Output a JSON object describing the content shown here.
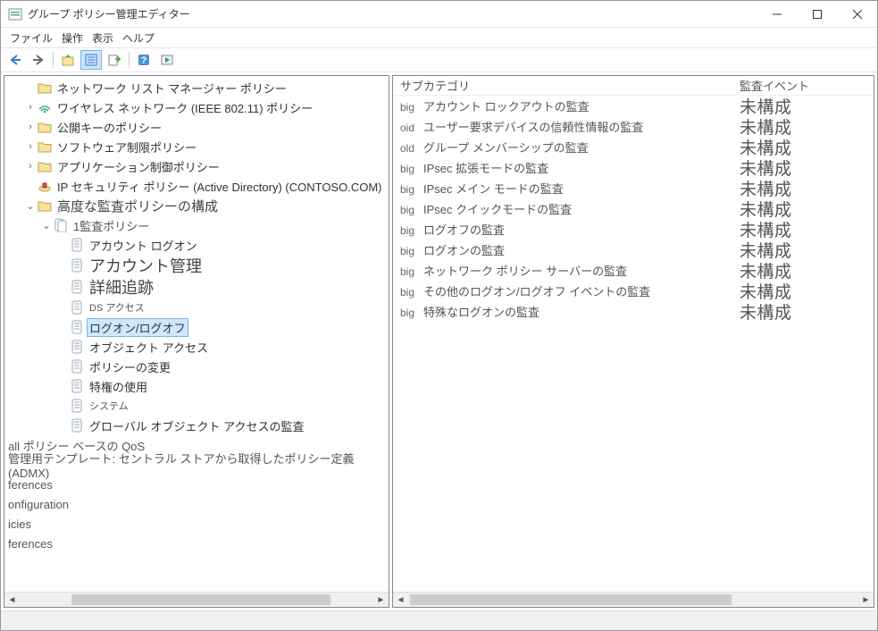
{
  "window": {
    "title": "グループ ポリシー管理エディター"
  },
  "menu": {
    "file": "ファイル",
    "action": "操作",
    "view": "表示",
    "help": "ヘルプ"
  },
  "tree": {
    "items": [
      {
        "label": "ネットワーク リスト マネージャー ポリシー",
        "icon": "folder",
        "indent": 1
      },
      {
        "label": "ワイヤレス ネットワーク (IEEE 802.11) ポリシー",
        "icon": "wifi",
        "indent": 1,
        "twisty": ">"
      },
      {
        "label": "公開キーのポリシー",
        "icon": "folder",
        "indent": 1,
        "twisty": ">"
      },
      {
        "label": "ソフトウェア制限ポリシー",
        "icon": "folder",
        "indent": 1,
        "twisty": ">"
      },
      {
        "label": "アプリケーション制御ポリシー",
        "icon": "folder",
        "indent": 1,
        "twisty": ">"
      },
      {
        "label": "IP セキュリティ ポリシー (Active Directory) (CONTOSO.COM)",
        "icon": "ipsec",
        "indent": 1
      },
      {
        "label": "高度な監査ポリシーの構成",
        "icon": "folder",
        "indent": 1,
        "twisty": "v",
        "cls": "med"
      }
    ],
    "audit": {
      "label": "監査ポリシー",
      "children": [
        {
          "label": "アカウント ログオン",
          "cls": ""
        },
        {
          "label": "アカウント管理",
          "cls": "big"
        },
        {
          "label": "詳細追跡",
          "cls": "big"
        },
        {
          "label": "DS アクセス",
          "cls": "small"
        },
        {
          "label": "ログオン/ログオフ",
          "cls": "",
          "selected": true
        },
        {
          "label": "オブジェクト アクセス",
          "cls": ""
        },
        {
          "label": "ポリシーの変更",
          "cls": ""
        },
        {
          "label": "特権の使用",
          "cls": ""
        },
        {
          "label": "システム",
          "cls": "small"
        },
        {
          "label": "グローバル オブジェクト アクセスの監査",
          "cls": ""
        }
      ]
    },
    "trailing": [
      "ポリシー ベースの QoS",
      "管理用テンプレート: セントラル ストアから取得したポリシー定義 (ADMX)",
      "ferences",
      "onfiguration",
      "icies",
      "ferences"
    ],
    "trailing_prefix0": "all"
  },
  "list": {
    "headers": {
      "col1": "サブカテゴリ",
      "col2": "監査イベント"
    },
    "rows": [
      {
        "prefix": "big",
        "label": "アカウント ロックアウトの監査",
        "event": "未構成"
      },
      {
        "prefix": "oid",
        "label": "ユーザー要求デバイスの信頼性情報の監査",
        "event": "未構成"
      },
      {
        "prefix": "old",
        "label": "グループ メンバーシップの監査",
        "event": "未構成"
      },
      {
        "prefix": "big",
        "label": "IPsec 拡張モードの監査",
        "event": "未構成"
      },
      {
        "prefix": "big",
        "label": "IPsec メイン モードの監査",
        "event": "未構成"
      },
      {
        "prefix": "big",
        "label": "IPsec クイックモードの監査",
        "event": "未構成"
      },
      {
        "prefix": "big",
        "label": "ログオフの監査",
        "event": "未構成"
      },
      {
        "prefix": "big",
        "label": "ログオンの監査",
        "event": "未構成"
      },
      {
        "prefix": "big",
        "label": "ネットワーク ポリシー サーバーの監査",
        "event": "未構成"
      },
      {
        "prefix": "big",
        "label": "その他のログオン/ログオフ イベントの監査",
        "event": "未構成"
      },
      {
        "prefix": "big",
        "label": "特殊なログオンの監査",
        "event": "未構成"
      }
    ]
  }
}
